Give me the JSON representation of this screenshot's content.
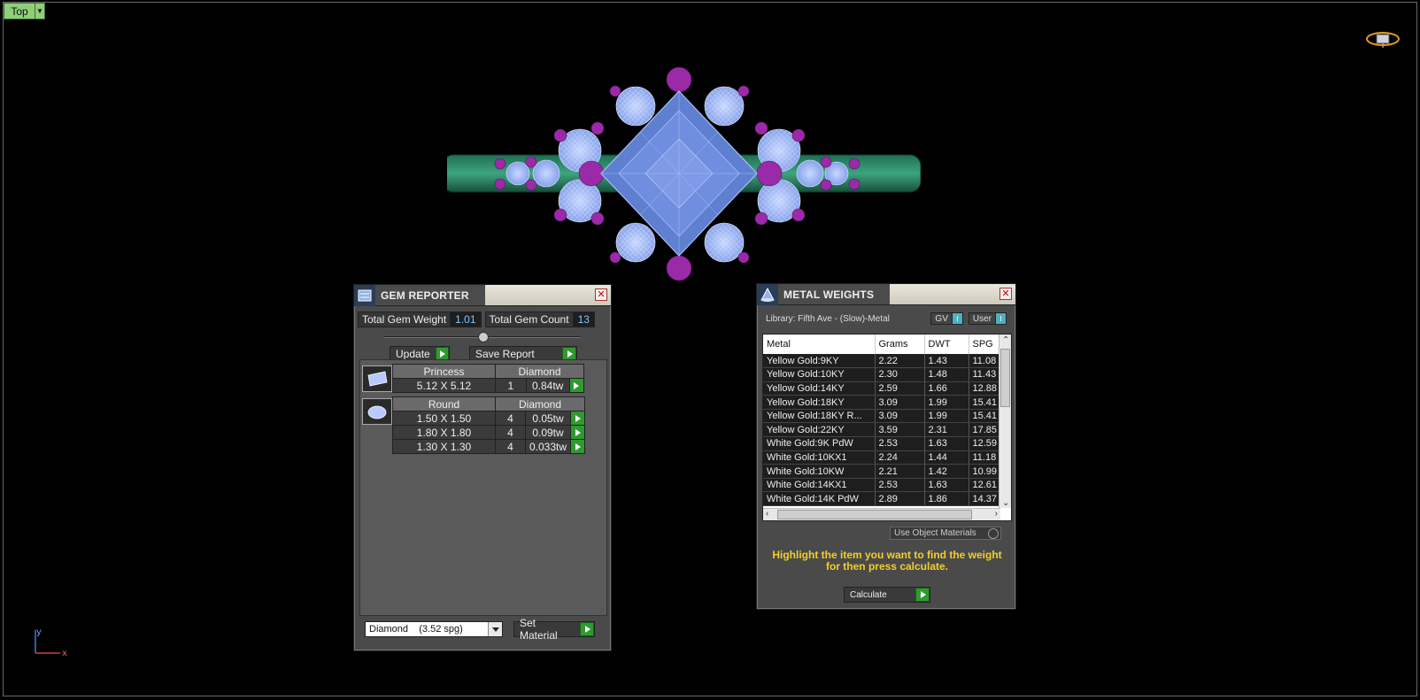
{
  "viewport": {
    "view_label": "Top",
    "axis_x": "x",
    "axis_y": "y"
  },
  "gem_reporter": {
    "title": "GEM REPORTER",
    "total_gem_weight_label": "Total Gem Weight",
    "total_gem_weight": "1.01",
    "total_gem_count_label": "Total Gem Count",
    "total_gem_count": "13",
    "update_label": "Update",
    "save_report_label": "Save Report",
    "groups": [
      {
        "shape": "Princess",
        "material": "Diamond",
        "rows": [
          {
            "size": "5.12 X 5.12",
            "count": "1",
            "weight": "0.84tw"
          }
        ]
      },
      {
        "shape": "Round",
        "material": "Diamond",
        "rows": [
          {
            "size": "1.50 X 1.50",
            "count": "4",
            "weight": "0.05tw"
          },
          {
            "size": "1.80 X 1.80",
            "count": "4",
            "weight": "0.09tw"
          },
          {
            "size": "1.30 X 1.30",
            "count": "4",
            "weight": "0.033tw"
          }
        ]
      }
    ],
    "material_select": "Diamond    (3.52 spg)",
    "set_material_label": "Set Material"
  },
  "metal_weights": {
    "title": "METAL WEIGHTS",
    "library": "Library: Fifth Ave - (Slow)-Metal",
    "gv_label": "GV",
    "user_label": "User",
    "columns": [
      "Metal",
      "Grams",
      "DWT",
      "SPG"
    ],
    "rows": [
      [
        "Yellow Gold:9KY",
        "2.22",
        "1.43",
        "11.08"
      ],
      [
        "Yellow Gold:10KY",
        "2.30",
        "1.48",
        "11.43"
      ],
      [
        "Yellow Gold:14KY",
        "2.59",
        "1.66",
        "12.88"
      ],
      [
        "Yellow Gold:18KY",
        "3.09",
        "1.99",
        "15.41"
      ],
      [
        "Yellow Gold:18KY R...",
        "3.09",
        "1.99",
        "15.41"
      ],
      [
        "Yellow Gold:22KY",
        "3.59",
        "2.31",
        "17.85"
      ],
      [
        "White Gold:9K PdW",
        "2.53",
        "1.63",
        "12.59"
      ],
      [
        "White Gold:10KX1",
        "2.24",
        "1.44",
        "11.18"
      ],
      [
        "White Gold:10KW",
        "2.21",
        "1.42",
        "10.99"
      ],
      [
        "White Gold:14KX1",
        "2.53",
        "1.63",
        "12.61"
      ],
      [
        "White Gold:14K PdW",
        "2.89",
        "1.86",
        "14.37"
      ]
    ],
    "use_object_materials": "Use Object Materials",
    "hint_line1": "Highlight the item you want to find the weight",
    "hint_line2": "for then press calculate.",
    "calculate_label": "Calculate"
  }
}
